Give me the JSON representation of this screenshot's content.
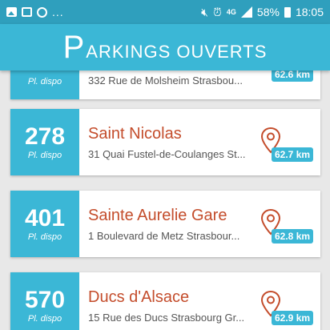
{
  "status_bar": {
    "dots": "...",
    "network": "4G",
    "battery": "58%",
    "time": "18:05"
  },
  "appbar": {
    "title_first": "P",
    "title_rest": "ARKINGS OUVERTS"
  },
  "parkings": [
    {
      "count": "",
      "label": "Pl. dispo",
      "name": "",
      "address": "332 Rue de Molsheim Strasbou...",
      "distance": "62.6 km"
    },
    {
      "count": "278",
      "label": "Pl. dispo",
      "name": "Saint Nicolas",
      "address": "31 Quai Fustel-de-Coulanges St...",
      "distance": "62.7 km"
    },
    {
      "count": "401",
      "label": "Pl. dispo",
      "name": "Sainte Aurelie Gare",
      "address": "1 Boulevard de Metz Strasbour...",
      "distance": "62.8 km"
    },
    {
      "count": "570",
      "label": "Pl. dispo",
      "name": "Ducs d'Alsace",
      "address": "15 Rue des Ducs Strasbourg Gr...",
      "distance": "62.9 km"
    }
  ],
  "colors": {
    "accent": "#3bb7d6",
    "status_bar": "#2f9fbd",
    "name_text": "#c44d2c"
  }
}
